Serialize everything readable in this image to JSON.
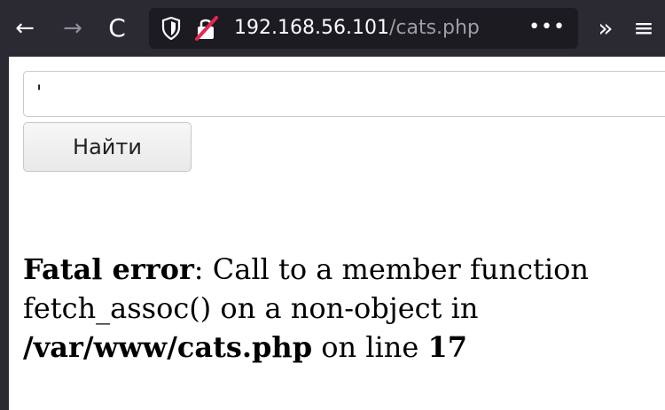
{
  "browser": {
    "back_icon": "←",
    "forward_icon": "→",
    "reload_icon": "C",
    "url": {
      "host": "192.168.56.101",
      "path": "/cats.php"
    },
    "url_more_label": "•••",
    "overflow_icon": "»",
    "menu_icon": "≡"
  },
  "page": {
    "search": {
      "value": "'"
    },
    "submit_label": "Найти",
    "error": {
      "label": "Fatal error",
      "message_1": ": Call to a member function fetch_assoc() on a non-object in ",
      "file": "/var/www/cats.php",
      "message_2": " on line ",
      "line": "17"
    }
  },
  "colors": {
    "toolbar_bg": "#2b2a33",
    "urlbar_bg": "#1c1b22",
    "url_text": "#fbfbfe",
    "url_path": "#9e9ea6",
    "lock_slash": "#e22850"
  }
}
